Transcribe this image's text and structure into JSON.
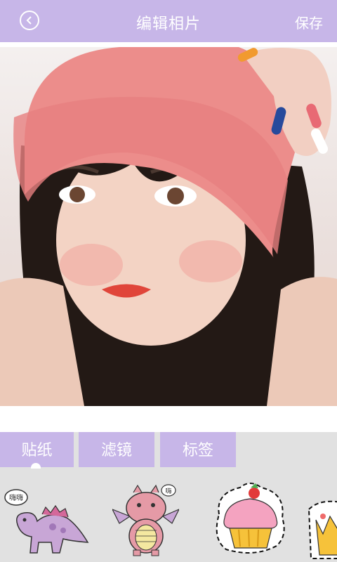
{
  "header": {
    "title": "编辑相片",
    "save_label": "保存",
    "back_icon": "chevron-left-icon"
  },
  "tabs": [
    {
      "label": "贴纸",
      "selected": true
    },
    {
      "label": "滤镜",
      "selected": false
    },
    {
      "label": "标签",
      "selected": false
    }
  ],
  "stickers": [
    {
      "icon": "dinosaur-sticker-icon",
      "bubble_text": "嗨嗨"
    },
    {
      "icon": "dragon-sticker-icon",
      "bubble_text": "嗨"
    },
    {
      "icon": "cupcake-sticker-icon"
    },
    {
      "icon": "crown-sticker-icon"
    }
  ],
  "colors": {
    "accent": "#c7b6e8",
    "panel": "#e1e1e1"
  }
}
